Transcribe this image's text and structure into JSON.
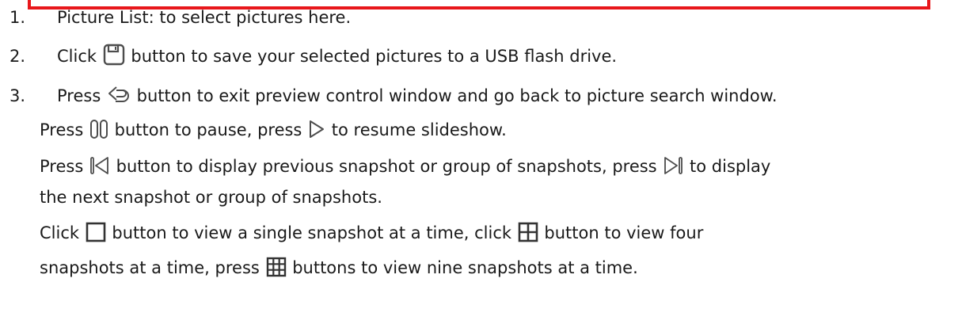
{
  "colors": {
    "box_border": "#e8171b",
    "text": "#1a1a1a",
    "icon_stroke": "#4d4d4d"
  },
  "icons": [
    "save-icon",
    "back-icon",
    "pause-icon",
    "play-icon",
    "previous-icon",
    "next-icon",
    "single-view-icon",
    "four-view-icon",
    "nine-view-icon"
  ],
  "items": [
    {
      "num": "1.",
      "text": "Picture List: to select pictures here."
    },
    {
      "num": "2.",
      "pre": "Click",
      "post": "button to save your selected pictures to a USB flash drive."
    },
    {
      "num": "3.",
      "pre": "Press",
      "post": "button to exit preview control window and go back to picture search window."
    }
  ],
  "details": {
    "pause_pre": "Press",
    "pause_mid": "button to pause, press",
    "pause_post": "to resume slideshow.",
    "prev_pre": "Press",
    "prev_mid": "button to display previous snapshot or group of snapshots, press",
    "prev_post": "to display",
    "prev_cont": "the next snapshot or group of snapshots.",
    "view_pre": "Click",
    "view_mid1": "button to view a single snapshot at a time, click",
    "view_mid2": "button to view four",
    "view_cont_pre": "snapshots at a time, press",
    "view_cont_post": "buttons to view nine snapshots at a time."
  }
}
